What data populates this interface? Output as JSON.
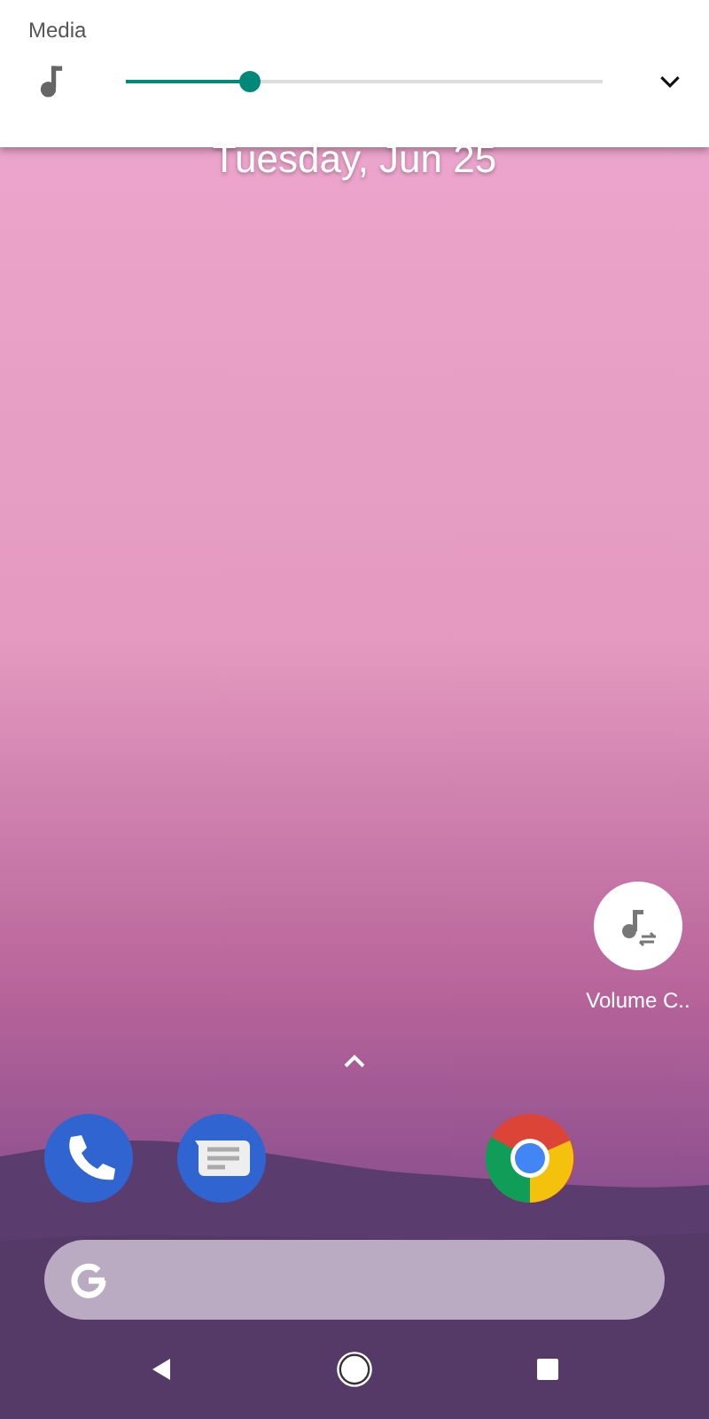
{
  "volume_panel": {
    "title": "Media",
    "slider": {
      "level": 0.26
    }
  },
  "home": {
    "date": "Tuesday, Jun 25",
    "shortcut": {
      "label": "Volume C.."
    }
  }
}
